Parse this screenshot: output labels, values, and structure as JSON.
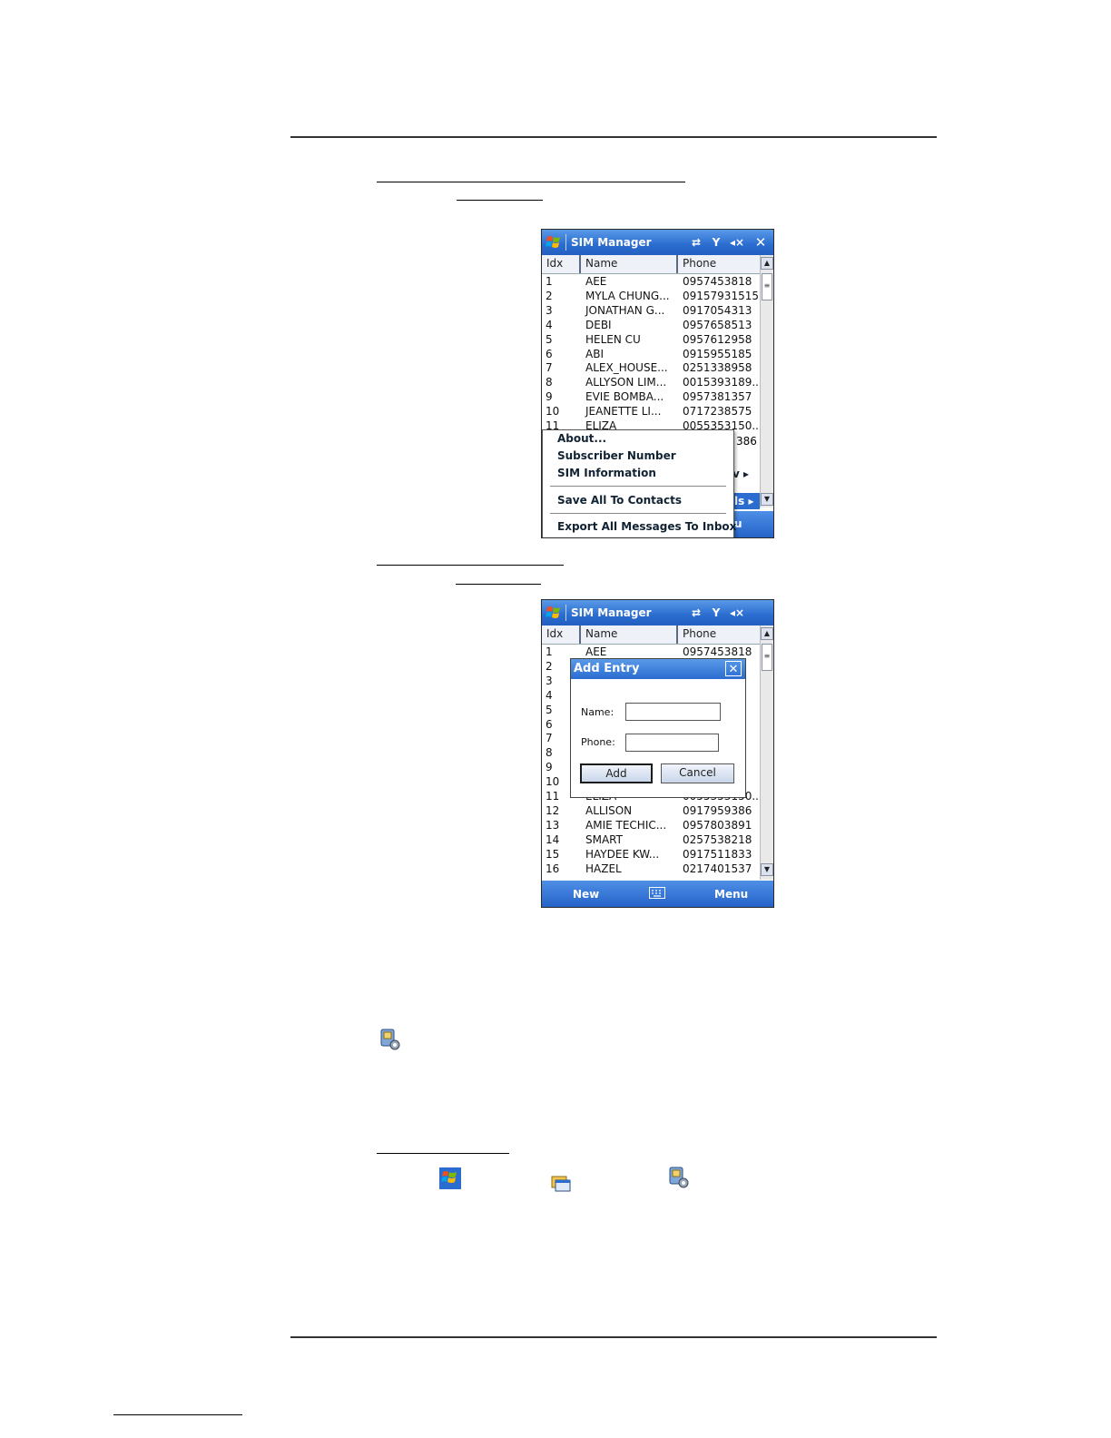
{
  "screenshot1": {
    "title": "SIM Manager",
    "columns": [
      "Idx",
      "Name",
      "Phone"
    ],
    "rows": [
      {
        "idx": "1",
        "name": "AEE",
        "phone": "0957453818"
      },
      {
        "idx": "2",
        "name": "MYLA CHUNG...",
        "phone": "09157931515"
      },
      {
        "idx": "3",
        "name": "JONATHAN G...",
        "phone": "0917054313"
      },
      {
        "idx": "4",
        "name": "DEBI",
        "phone": "0957658513"
      },
      {
        "idx": "5",
        "name": "HELEN CU",
        "phone": "0957612958"
      },
      {
        "idx": "6",
        "name": "ABI",
        "phone": "0915955185"
      },
      {
        "idx": "7",
        "name": "ALEX_HOUSE...",
        "phone": "0251338958"
      },
      {
        "idx": "8",
        "name": "ALLYSON LIM...",
        "phone": "0015393189..."
      },
      {
        "idx": "9",
        "name": "EVIE BOMBA...",
        "phone": "0957381357"
      },
      {
        "idx": "10",
        "name": "JEANETTE LI...",
        "phone": "0717238575"
      },
      {
        "idx": "11",
        "name": "ELIZA",
        "phone": "0055353150..."
      }
    ],
    "partial_row_phone": "386",
    "menu_items": [
      "About...",
      "Subscriber Number",
      "SIM Information",
      "Save All To Contacts",
      "Export All Messages To Inbox"
    ],
    "behind_menu": {
      "view_label": "v",
      "tools_label": "ls",
      "menu_label": "u"
    }
  },
  "screenshot2": {
    "title": "SIM Manager",
    "columns": [
      "Idx",
      "Name",
      "Phone"
    ],
    "rows": [
      {
        "idx": "1",
        "name": "AEE",
        "phone": "0957453818"
      },
      {
        "idx": "2",
        "name": "",
        "phone": "15"
      },
      {
        "idx": "3",
        "name": "",
        "phone": "3"
      },
      {
        "idx": "4",
        "name": "",
        "phone": "3"
      },
      {
        "idx": "5",
        "name": "",
        "phone": "8"
      },
      {
        "idx": "6",
        "name": "",
        "phone": "5"
      },
      {
        "idx": "7",
        "name": "",
        "phone": "8"
      },
      {
        "idx": "8",
        "name": "",
        "phone": "9..."
      },
      {
        "idx": "9",
        "name": "",
        "phone": "7"
      },
      {
        "idx": "10",
        "name": "",
        "phone": "5"
      },
      {
        "idx": "11",
        "name": "ELIZA",
        "phone": "0055353150..."
      },
      {
        "idx": "12",
        "name": "ALLISON",
        "phone": "0917959386"
      },
      {
        "idx": "13",
        "name": "AMIE TECHIC...",
        "phone": "0957803891"
      },
      {
        "idx": "14",
        "name": "SMART",
        "phone": "0257538218"
      },
      {
        "idx": "15",
        "name": "HAYDEE KW...",
        "phone": "0917511833"
      },
      {
        "idx": "16",
        "name": "HAZEL",
        "phone": "0217401537"
      }
    ],
    "dialog": {
      "title": "Add Entry",
      "name_label": "Name:",
      "phone_label": "Phone:",
      "name_value": "",
      "phone_value": "",
      "add_label": "Add",
      "cancel_label": "Cancel"
    },
    "softkeys": {
      "left": "New",
      "right": "Menu"
    }
  },
  "icons": {
    "sim-settings": "sim-manager-icon",
    "start": "windows-start-icon",
    "programs": "programs-folder-icon",
    "sim": "sim-manager-icon"
  },
  "colors": {
    "titlebar": "#2a6cd0",
    "softbar": "#2563c8"
  }
}
